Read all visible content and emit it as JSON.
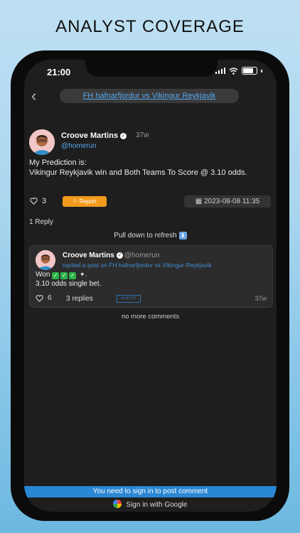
{
  "headline": "ANALYST COVERAGE",
  "status_bar": {
    "time": "21:00"
  },
  "header": {
    "match_title": "FH hafnarfjordur vs Vikingur Reykjavik"
  },
  "post": {
    "author": "Croove Martins",
    "age": "37w",
    "handle": "@homerun",
    "body_line1": "My Prediction is:",
    "body_line2": "Vikingur Reykjavik win and Both Teams To Score @ 3.10 odds.",
    "likes": "3",
    "report_label": "Report",
    "date": "2023-08-08 11:35"
  },
  "replies_count_label": "1 Reply",
  "pull_to_refresh": "Pull down to refresh",
  "comment": {
    "author": "Croove Martins",
    "handle": "@homerun",
    "replied_text": "replied a post on FH hafnarfjordur vs Vikingur Reykjavik",
    "body_prefix": "Won",
    "body_suffix": ".",
    "body_line2": "3.10 odds single bet.",
    "likes": "6",
    "replies_label": "3 replies",
    "tag": "ANALYST",
    "age": "37w"
  },
  "no_more": "no more comments",
  "signin_prompt": "You need to sign in to post comment",
  "google_signin": "Sign in with Google",
  "colors": {
    "accent_blue": "#56a8f0",
    "report_orange": "#f29a1b",
    "signin_bar": "#2a87d4"
  }
}
